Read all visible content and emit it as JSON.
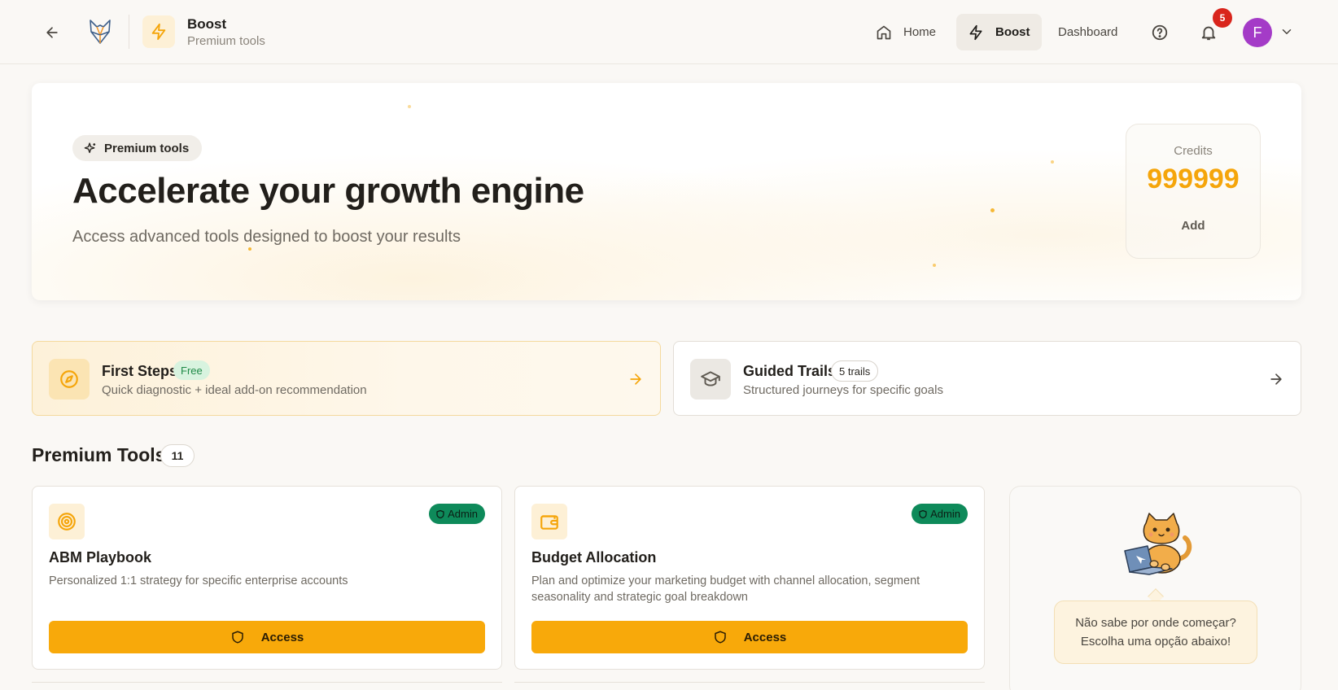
{
  "header": {
    "app_title": "Boost",
    "app_subtitle": "Premium tools",
    "nav": [
      {
        "label": "Home",
        "icon": "home-icon"
      },
      {
        "label": "Boost",
        "icon": "bolt-icon",
        "active": true
      },
      {
        "label": "Dashboard"
      }
    ],
    "notification_count": "5",
    "avatar_initial": "F"
  },
  "hero": {
    "pill": "Premium tools",
    "title": "Accelerate your growth engine",
    "subtitle": "Access advanced tools designed to boost your results",
    "credits_label": "Credits",
    "credits_value": "999999",
    "credits_add": "Add"
  },
  "quick_cards": [
    {
      "title": "First Steps",
      "badge": "Free",
      "description": "Quick diagnostic + ideal add-on recommendation",
      "icon": "compass-icon"
    },
    {
      "title": "Guided Trails",
      "badge": "5 trails",
      "description": "Structured journeys for specific goals",
      "icon": "graduation-cap-icon"
    }
  ],
  "section": {
    "title": "Premium Tools",
    "count": "11"
  },
  "tools": [
    {
      "title": "ABM Playbook",
      "badge": "Admin",
      "description": "Personalized 1:1 strategy for specific enterprise accounts",
      "button": "Access",
      "icon": "target-icon"
    },
    {
      "title": "Budget Allocation",
      "badge": "Admin",
      "description": "Plan and optimize your marketing budget with channel allocation, segment seasonality and strategic goal breakdown",
      "button": "Access",
      "icon": "wallet-icon"
    }
  ],
  "assistant": {
    "line1": "Não sabe por onde começar?",
    "line2": "Escolha uma opção abaixo!"
  },
  "colors": {
    "accent": "#f8a90a",
    "admin_badge": "#0e8a5a",
    "notification": "#d9251c",
    "avatar": "#a43bc7"
  }
}
